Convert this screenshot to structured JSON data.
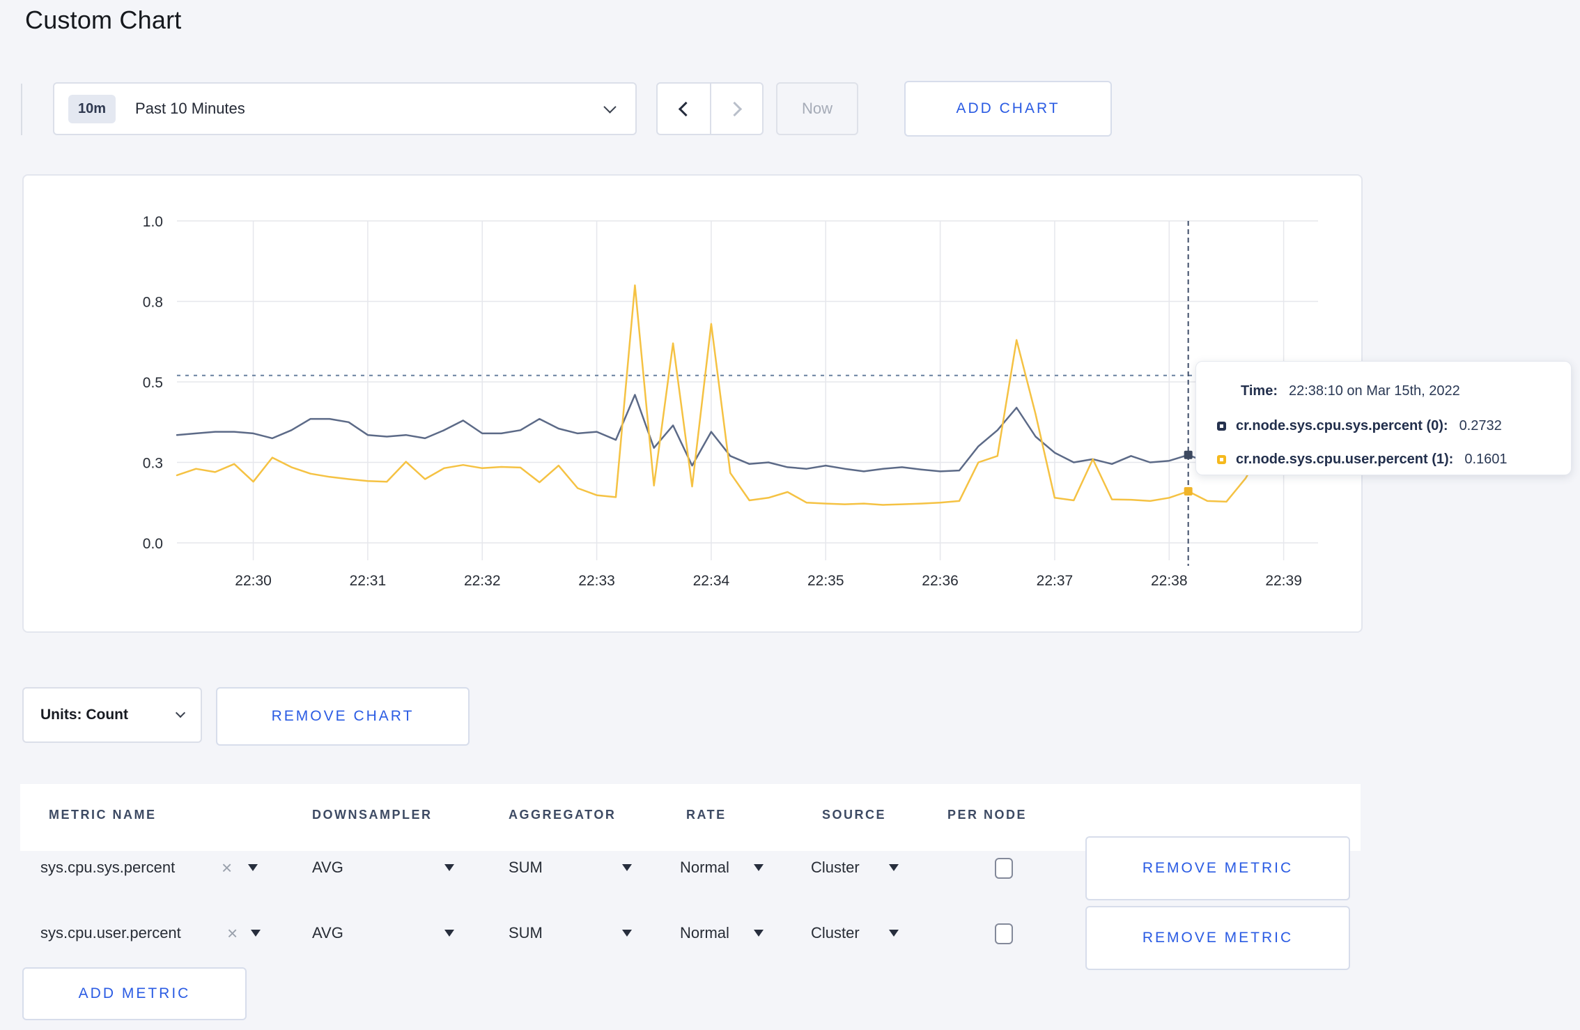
{
  "page": {
    "title": "Custom Chart"
  },
  "toolbar": {
    "time_window_badge": "10m",
    "time_window_label": "Past 10 Minutes",
    "now_label": "Now",
    "add_chart_label": "ADD CHART"
  },
  "chart_data": {
    "type": "line",
    "x_start": "22:29:20",
    "x_interval_seconds": 10,
    "x_tick_labels": [
      "22:30",
      "22:31",
      "22:32",
      "22:33",
      "22:34",
      "22:35",
      "22:36",
      "22:37",
      "22:38",
      "22:39"
    ],
    "x_tick_indices": [
      4,
      10,
      16,
      22,
      28,
      34,
      40,
      46,
      52,
      58
    ],
    "ylim": [
      0,
      1
    ],
    "y_ticks": [
      {
        "value": 0.0,
        "label": "0.0"
      },
      {
        "value": 0.25,
        "label": "0.3"
      },
      {
        "value": 0.5,
        "label": "0.5"
      },
      {
        "value": 0.75,
        "label": "0.8"
      },
      {
        "value": 1.0,
        "label": "1.0"
      }
    ],
    "grid": true,
    "legend_position": "none",
    "series": [
      {
        "key": "sys",
        "name": "cr.node.sys.cpu.sys.percent (0)",
        "color": "#5c6a87",
        "dot_color": "#3d4960",
        "values": [
          0.335,
          0.34,
          0.345,
          0.345,
          0.34,
          0.325,
          0.35,
          0.385,
          0.385,
          0.375,
          0.335,
          0.33,
          0.335,
          0.325,
          0.35,
          0.38,
          0.34,
          0.34,
          0.35,
          0.385,
          0.355,
          0.34,
          0.345,
          0.32,
          0.46,
          0.295,
          0.365,
          0.24,
          0.345,
          0.27,
          0.245,
          0.25,
          0.235,
          0.23,
          0.24,
          0.23,
          0.222,
          0.23,
          0.235,
          0.228,
          0.222,
          0.225,
          0.3,
          0.35,
          0.42,
          0.33,
          0.28,
          0.25,
          0.26,
          0.245,
          0.27,
          0.25,
          0.255,
          0.2732,
          0.25,
          0.26,
          0.285,
          0.27,
          0.29,
          0.28
        ]
      },
      {
        "key": "user",
        "name": "cr.node.sys.cpu.user.percent (1)",
        "color": "#f5c243",
        "dot_color": "#f0b429",
        "values": [
          0.21,
          0.23,
          0.22,
          0.245,
          0.19,
          0.265,
          0.235,
          0.215,
          0.205,
          0.198,
          0.192,
          0.19,
          0.252,
          0.198,
          0.232,
          0.242,
          0.232,
          0.236,
          0.234,
          0.188,
          0.24,
          0.17,
          0.148,
          0.142,
          0.8,
          0.178,
          0.62,
          0.175,
          0.68,
          0.217,
          0.132,
          0.14,
          0.158,
          0.125,
          0.122,
          0.12,
          0.122,
          0.118,
          0.12,
          0.122,
          0.125,
          0.13,
          0.25,
          0.27,
          0.63,
          0.4,
          0.14,
          0.132,
          0.26,
          0.135,
          0.134,
          0.13,
          0.14,
          0.1601,
          0.13,
          0.128,
          0.2,
          0.3,
          0.22,
          0.26
        ]
      }
    ],
    "crosshair": {
      "index": 53,
      "time": "22:38:10",
      "hline_value": 0.52
    }
  },
  "tooltip": {
    "time_label": "Time:",
    "time_value": "22:38:10 on Mar 15th, 2022",
    "series": [
      {
        "label": "cr.node.sys.cpu.sys.percent (0):",
        "value": "0.2732",
        "color": "#26324e"
      },
      {
        "label": "cr.node.sys.cpu.user.percent (1):",
        "value": "0.1601",
        "color": "#f5b91e"
      }
    ]
  },
  "chart_footer": {
    "units_label": "Units: Count",
    "remove_chart_label": "REMOVE CHART"
  },
  "metrics_table": {
    "columns": [
      "METRIC NAME",
      "DOWNSAMPLER",
      "AGGREGATOR",
      "RATE",
      "SOURCE",
      "PER NODE"
    ],
    "rows": [
      {
        "metric": "sys.cpu.sys.percent",
        "downsampler": "AVG",
        "aggregator": "SUM",
        "rate": "Normal",
        "source": "Cluster",
        "per_node_checked": false,
        "remove_label": "REMOVE METRIC"
      },
      {
        "metric": "sys.cpu.user.percent",
        "downsampler": "AVG",
        "aggregator": "SUM",
        "rate": "Normal",
        "source": "Cluster",
        "per_node_checked": false,
        "remove_label": "REMOVE METRIC"
      }
    ],
    "add_metric_label": "ADD METRIC"
  }
}
